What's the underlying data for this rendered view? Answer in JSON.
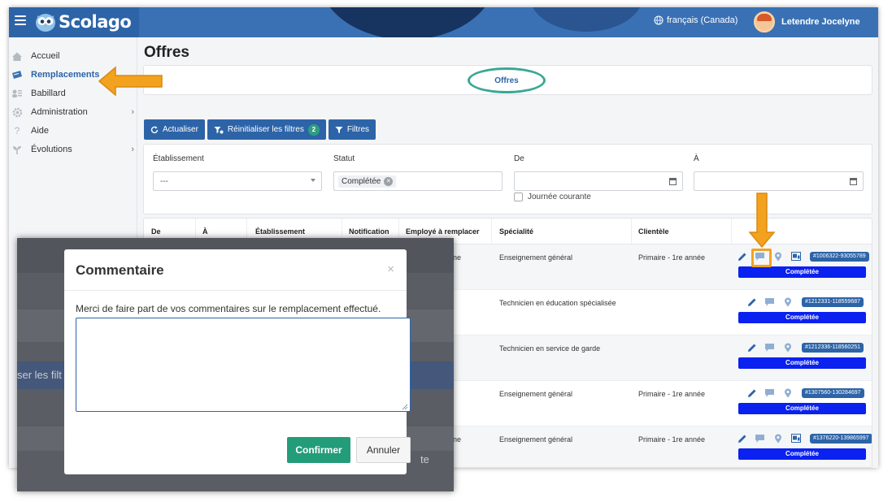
{
  "topbar": {
    "brand": "Scolago",
    "language": "français (Canada)",
    "user_name": "Letendre Jocelyne"
  },
  "sidebar": {
    "items": [
      {
        "label": "Accueil",
        "icon": "home-icon"
      },
      {
        "label": "Remplacements",
        "icon": "replacement-icon"
      },
      {
        "label": "Babillard",
        "icon": "board-icon"
      },
      {
        "label": "Administration",
        "icon": "gear-icon"
      },
      {
        "label": "Aide",
        "icon": "help-icon"
      },
      {
        "label": "Évolutions",
        "icon": "sprout-icon"
      }
    ]
  },
  "main": {
    "title": "Offres",
    "tab": "Offres",
    "buttons": {
      "refresh": "Actualiser",
      "reset": "Réinitialiser les filtres",
      "reset_count": "2",
      "filters": "Filtres"
    },
    "filters": {
      "establishment_label": "Établissement",
      "establishment_value": "---",
      "status_label": "Statut",
      "status_chip": "Complétée",
      "from_label": "De",
      "to_label": "À",
      "current_day": "Journée courante"
    },
    "table": {
      "headers": [
        "De",
        "À",
        "Établissement",
        "Notification",
        "Employé à remplacer",
        "Spécialité",
        "Clientèle"
      ],
      "rows": [
        {
          "employee_partial": "ne",
          "speciality": "Enseignement général",
          "clientele": "Primaire - 1re année",
          "id": "#1006322-93055789",
          "status": "Complétée"
        },
        {
          "employee_partial": "",
          "speciality": "Technicien en éducation spécialisée",
          "clientele": "",
          "id": "#1212331-118559687",
          "status": "Complétée"
        },
        {
          "employee_partial": "",
          "speciality": "Technicien en service de garde",
          "clientele": "",
          "id": "#1212336-118560251",
          "status": "Complétée"
        },
        {
          "employee_partial": "",
          "speciality": "Enseignement général",
          "clientele": "Primaire - 1re année",
          "id": "#1307560-130284697",
          "status": "Complétée"
        },
        {
          "employee_partial": "ne",
          "speciality": "Enseignement général",
          "clientele": "Primaire - 1re année",
          "id": "#1376220-139865997",
          "status": "Complétée"
        }
      ]
    }
  },
  "overlay_bg": {
    "partial_button": "ser les filt",
    "partial_text": "te"
  },
  "modal": {
    "title": "Commentaire",
    "close": "×",
    "message": "Merci de faire part de vos commentaires sur le remplacement effectué.",
    "textarea_value": "",
    "confirm": "Confirmer",
    "cancel": "Annuler"
  },
  "colors": {
    "primary": "#2d64a8",
    "topbar": "#3a71b5",
    "accent_orange": "#f3a21f",
    "teal": "#3aa894",
    "status_blue": "#0a21f0",
    "confirm_green": "#239c7a"
  }
}
